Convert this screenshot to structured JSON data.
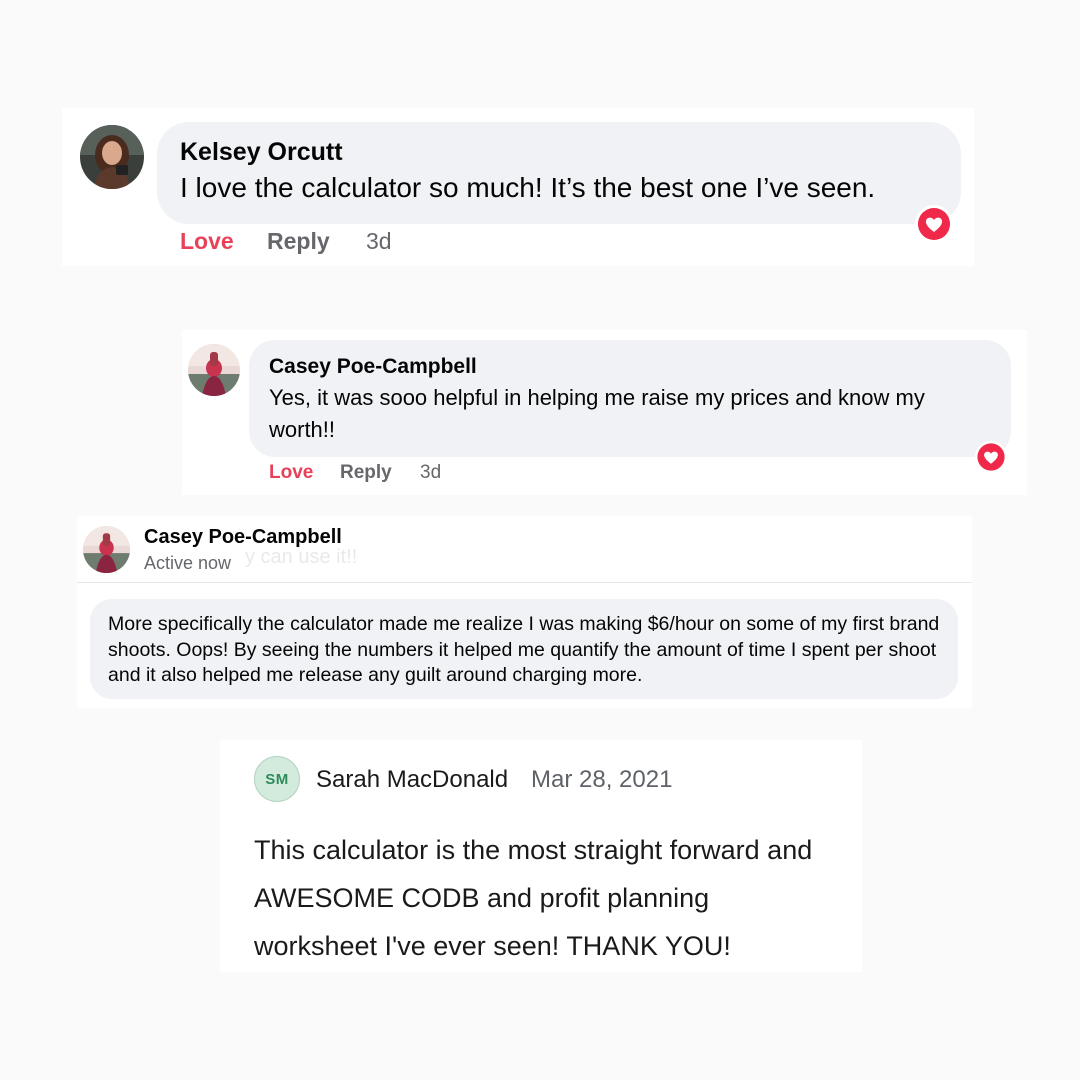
{
  "comments": {
    "first": {
      "author": "Kelsey Orcutt",
      "text": "I love the calculator so much! It’s the best one I’ve seen.",
      "love_label": "Love",
      "reply_label": "Reply",
      "time": "3d",
      "reaction_icon": "heart-icon",
      "reaction_color": "#f0284a"
    },
    "reply": {
      "author": "Casey Poe-Campbell",
      "text": "Yes, it was sooo helpful in helping me raise my prices and know my worth!!",
      "love_label": "Love",
      "reply_label": "Reply",
      "time": "3d",
      "reaction_icon": "heart-icon",
      "reaction_color": "#f0284a"
    }
  },
  "message": {
    "author": "Casey Poe-Campbell",
    "status": "Active now",
    "faded_text": "y can use it!!",
    "text": "More specifically the calculator made me realize I was making $6/hour on some of my first brand shoots. Oops! By seeing the numbers it helped me quantify the amount of time I spent per shoot and it also helped me release any guilt around charging more."
  },
  "review": {
    "initials": "SM",
    "author": "Sarah MacDonald",
    "date": "Mar 28, 2021",
    "text": "This calculator is the most straight forward and AWESOME CODB and profit planning worksheet I've ever seen! THANK YOU!"
  },
  "colors": {
    "love": "#e8425a",
    "muted": "#65676b",
    "bubble": "#f0f2f5",
    "initials_bg": "#d3ebdd",
    "initials_text": "#2e8b5a"
  }
}
